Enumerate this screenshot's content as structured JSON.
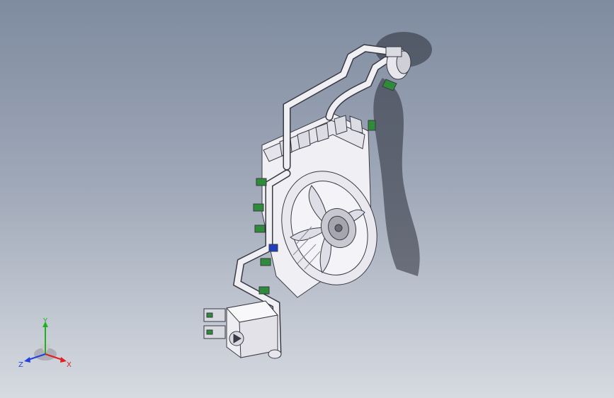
{
  "viewport": {
    "name": "3d-model-viewport"
  },
  "triad": {
    "x_label": "X",
    "y_label": "Y",
    "z_label": "Z",
    "x_color": "#e02020",
    "y_color": "#20b020",
    "z_color": "#2040e0"
  },
  "model": {
    "part_color": "#f0f0f4",
    "edge_color": "#3a3a44",
    "accent_green": "#2e8b3a",
    "accent_blue": "#1f3fbf",
    "shadow_color": "#2a2e38"
  }
}
